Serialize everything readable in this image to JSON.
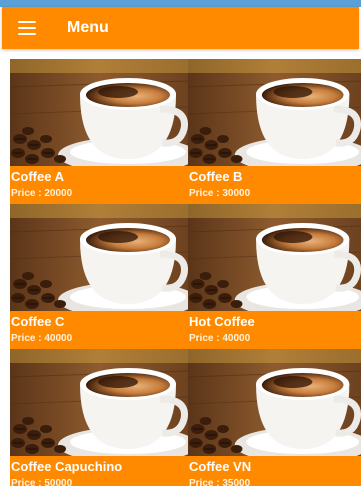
{
  "app_bar": {
    "title": "Menu",
    "menu_icon": "hamburger-menu-icon",
    "color": "#ff8a00"
  },
  "products": [
    {
      "name": "Coffee A",
      "price": "Price : 20000",
      "image": "coffee-cup-photo"
    },
    {
      "name": "Coffee B",
      "price": "Price : 30000",
      "image": "coffee-cup-photo"
    },
    {
      "name": "Coffee C",
      "price": "Price : 40000",
      "image": "coffee-cup-photo"
    },
    {
      "name": "Hot Coffee",
      "price": "Price : 40000",
      "image": "coffee-cup-photo"
    },
    {
      "name": "Coffee Capuchino",
      "price": "Price : 50000",
      "image": "coffee-cup-photo"
    },
    {
      "name": "Coffee VN",
      "price": "Price : 35000",
      "image": "coffee-cup-photo"
    }
  ]
}
